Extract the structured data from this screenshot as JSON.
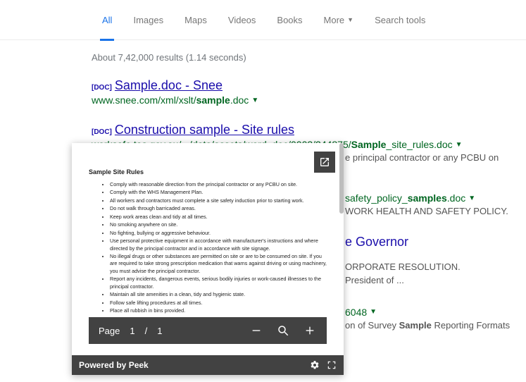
{
  "tabs": {
    "all": "All",
    "images": "Images",
    "maps": "Maps",
    "videos": "Videos",
    "books": "Books",
    "more": "More",
    "search_tools": "Search tools"
  },
  "stats": "About 7,42,000 results (1.14 seconds)",
  "doc_tag": "[DOC]",
  "results": {
    "r1": {
      "title": "Sample.doc - Snee",
      "url_pre": "www.snee.com/xml/xslt/",
      "url_bold": "sample",
      "url_post": ".doc"
    },
    "r2": {
      "title": "Construction sample - Site rules",
      "url_pre": "worksafe.tas.gov.au/.../data/assets/word_doc/0003/244875/",
      "url_bold": "Sample",
      "url_post": "_site_rules.doc",
      "snip": "e principal contractor or any PCBU on"
    },
    "r3": {
      "url_post_a": "safety_policy_",
      "url_bold": "samples",
      "url_post_b": ".doc",
      "snip": "WORK HEALTH AND SAFETY POLICY."
    },
    "r4": {
      "title_frag": "e Governor",
      "snip1": "ORPORATE RESOLUTION.",
      "snip2": "President of ..."
    },
    "r5": {
      "url_frag": "6048",
      "snip_a": "on of Survey ",
      "snip_bold": "Sample",
      "snip_b": " Reporting Formats"
    }
  },
  "peek": {
    "heading": "Sample Site Rules",
    "rules": [
      "Comply with reasonable direction from the principal contractor or any PCBU on site.",
      "Comply with the WHS Management Plan.",
      "All workers and contractors must complete a site safety induction prior to starting work.",
      "Do not walk through barricaded areas.",
      "Keep work areas clean and tidy at all times.",
      "No smoking anywhere on site.",
      "No fighting, bullying or aggressive behaviour.",
      "Use personal protective equipment in accordance with manufacturer's instructions and where directed by the principal contractor and in accordance with site signage.",
      "No illegal drugs or other substances are permitted on site or are to be consumed on site. If you are required to take strong prescription medication that warns against driving or using machinery, you must advise the principal contractor.",
      "Report any incidents, dangerous events, serious bodily injuries or work-caused illnesses to the principal contractor.",
      "Maintain all site amenities in a clean, tidy and hygienic state.",
      "Follow safe lifting procedures at all times.",
      "Place all rubbish in bins provided."
    ],
    "page_label": "Page",
    "page_current": "1",
    "page_sep": "/",
    "page_total": "1",
    "footer": "Powered by Peek"
  }
}
